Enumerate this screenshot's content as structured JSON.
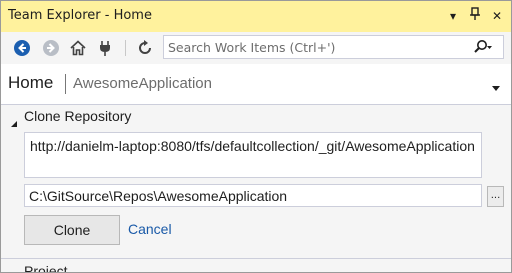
{
  "window": {
    "title": "Team Explorer - Home",
    "dropdown_glyph": "▾",
    "pin_glyph": "ᛘ",
    "close_glyph": "✕"
  },
  "toolbar": {
    "search_placeholder": "Search Work Items (Ctrl+')",
    "icons": [
      "back-icon",
      "forward-icon",
      "home-icon",
      "connect-icon",
      "refresh-icon",
      "search-icon"
    ],
    "accent": "#1c5fb0"
  },
  "home": {
    "title": "Home",
    "project": "AwesomeApplication"
  },
  "clone_section": {
    "label": "Clone Repository",
    "url_value": "http://danielm-laptop:8080/tfs/defaultcollection/_git/AwesomeApplication",
    "path_value": "C:\\GitSource\\Repos\\AwesomeApplication",
    "browse_label": "...",
    "clone_label": "Clone",
    "cancel_label": "Cancel"
  },
  "next_section": {
    "label": "Project"
  },
  "colors": {
    "title_bar": "#fff29d",
    "link": "#1a5aa8",
    "background": "#f5f5f5"
  }
}
